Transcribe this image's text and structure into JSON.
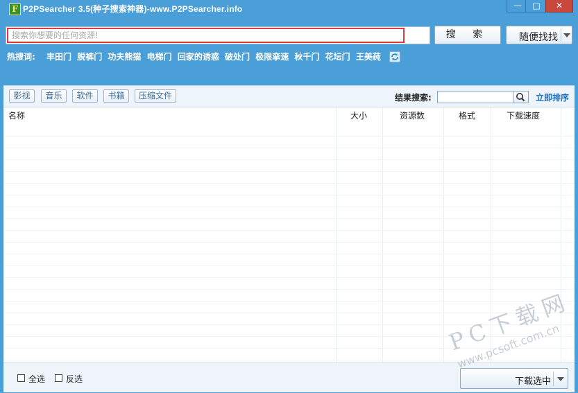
{
  "window": {
    "title": "P2PSearcher 3.5(种子搜索神器)-www.P2PSearcher.info",
    "icon_letter": "F",
    "controls": {
      "minimize": "—",
      "maximize": "□",
      "close": "✕"
    }
  },
  "search": {
    "placeholder": "搜索你想要的任何资源!",
    "search_button": "搜 索",
    "random_button": "随便找找"
  },
  "hot": {
    "label": "热搜词:",
    "keywords": [
      "丰田门",
      "脱裤门",
      "功夫熊猫",
      "电梯门",
      "回家的诱惑",
      "破处门",
      "极限挛速",
      "秋千门",
      "花坛门",
      "王美莼"
    ]
  },
  "categories": [
    "影视",
    "音乐",
    "软件",
    "书籍",
    "压缩文件"
  ],
  "results": {
    "label": "结果搜索:",
    "sort_link": "立即排序"
  },
  "table": {
    "columns": [
      "名称",
      "大小",
      "资源数",
      "格式",
      "下载速度"
    ]
  },
  "footer": {
    "select_all": "全选",
    "invert": "反选",
    "download_button": "下载选中"
  },
  "watermark": {
    "text": "PC下载网",
    "url": "www.pcsoft.com.cn"
  },
  "colors": {
    "frame": "#4b9fd9",
    "highlight_border": "#e03a3a",
    "link": "#1d6fc0"
  }
}
